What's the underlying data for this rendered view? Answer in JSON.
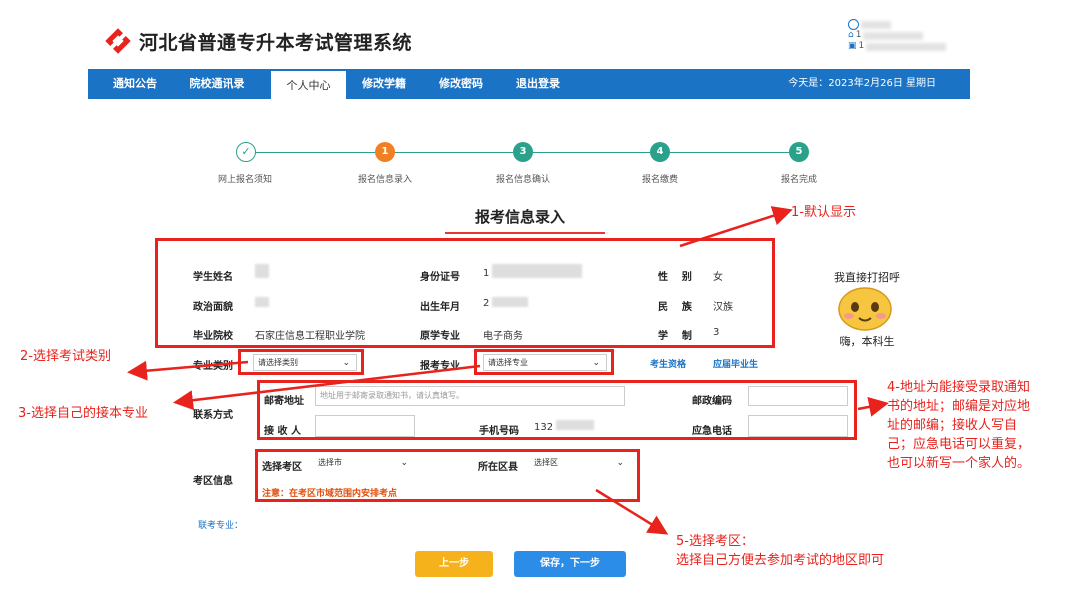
{
  "header": {
    "system_title": "河北省普通专升本考试管理系统",
    "user_line_1": "1",
    "user_line_2": "1"
  },
  "nav": {
    "items": [
      "通知公告",
      "院校通讯录",
      "个人中心",
      "修改学籍",
      "修改密码",
      "退出登录"
    ],
    "active": "个人中心",
    "date": "今天是：2023年2月26日 星期日"
  },
  "steps": [
    {
      "num": "",
      "label": "网上报名须知",
      "color": "#2aa18a"
    },
    {
      "num": "1",
      "label": "报名信息录入",
      "color": "#f08021"
    },
    {
      "num": "3",
      "label": "报名信息确认",
      "color": "#2aa18a"
    },
    {
      "num": "4",
      "label": "报名缴费",
      "color": "#2aa18a"
    },
    {
      "num": "5",
      "label": "报名完成",
      "color": "#2aa18a"
    }
  ],
  "page_title": "报考信息录入",
  "info": {
    "name_label": "学生姓名",
    "id_label": "身份证号",
    "id_value": "1",
    "gender_label": "性    别",
    "gender_value": "女",
    "political_label": "政治面貌",
    "birth_label": "出生年月",
    "birth_value": "2",
    "ethnic_label": "民    族",
    "ethnic_value": "汉族",
    "school_label": "毕业院校",
    "school_value": "石家庄信息工程职业学院",
    "major_label": "原学专业",
    "major_value": "电子商务",
    "duration_label": "学    制",
    "duration_value": "3"
  },
  "category": {
    "label": "专业类别",
    "select_value": "请选择类别",
    "major_label": "报考专业",
    "major_select": "请选择专业",
    "link1": "考生资格",
    "link2": "应届毕业生"
  },
  "contact": {
    "section_label": "联系方式",
    "address_label": "邮寄地址",
    "address_placeholder": "地址用于邮寄录取通知书，请认真填写。",
    "zip_label": "邮政编码",
    "receiver_label": "接 收 人",
    "phone_label": "手机号码",
    "phone_value": "132",
    "emergency_label": "应急电话"
  },
  "exam_area": {
    "section_label": "考区信息",
    "area_label": "选择考区",
    "area_select": "选择市",
    "district_label": "所在区县",
    "district_select": "选择区",
    "note": "注意：在考区市域范围内安排考点"
  },
  "joint_major_label": "联考专业：",
  "buttons": {
    "prev": "上一步",
    "next": "保存，下一步"
  },
  "sticker": {
    "caption_top": "我直接打招呼",
    "caption_bottom": "嗨，本科生"
  },
  "annotations": {
    "a1": "1-默认显示",
    "a2": "2-选择考试类别",
    "a3": "3-选择自己的接本专业",
    "a4_lines": [
      "4-地址为能接受录取通知",
      "书的地址；邮编是对应地",
      "址的邮编；接收人写自",
      "己；应急电话可以重复，",
      "也可以新写一个家人的。"
    ],
    "a5_lines": [
      "5-选择考区：",
      "选择自己方便去参加考试的地区即可"
    ]
  },
  "colors": {
    "nav_blue": "#1b73c5",
    "step_green": "#2aa18a",
    "step_orange": "#f08021",
    "annotation_red": "#e8221c",
    "prev_btn": "#f6b21b",
    "next_btn": "#2b8de8"
  }
}
